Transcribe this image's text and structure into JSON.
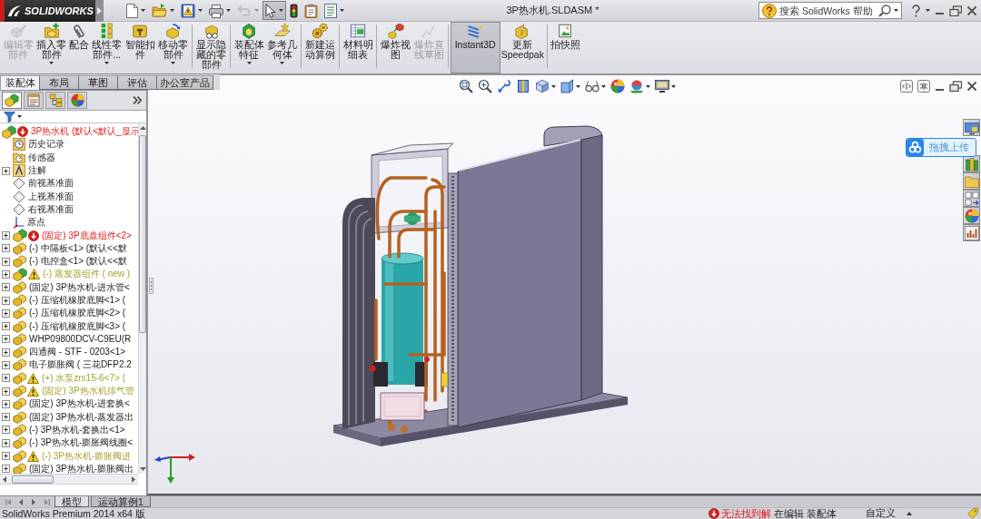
{
  "title_bar": {
    "logo": "SOLIDWORKS",
    "quick_access": [
      {
        "dropdown": true,
        "disabled": false,
        "pressed": false
      },
      {
        "dropdown": true,
        "disabled": false,
        "pressed": false
      },
      {
        "dropdown": true,
        "disabled": false,
        "pressed": false
      },
      {
        "dropdown": true,
        "disabled": false,
        "pressed": false
      },
      {
        "dropdown": true,
        "disabled": true,
        "pressed": false
      },
      {
        "dropdown": true,
        "disabled": false,
        "pressed": true
      },
      {
        "dropdown": false,
        "disabled": false,
        "pressed": false
      },
      {
        "dropdown": false,
        "disabled": false,
        "pressed": false
      },
      {
        "dropdown": true,
        "disabled": false,
        "pressed": false
      }
    ],
    "document_title": "3P热水机.SLDASM *",
    "search": {
      "placeholder": "搜索 SolidWorks 帮助"
    }
  },
  "command_manager": {
    "groups": [
      [
        {
          "label": "编辑零部件",
          "dropdown": false,
          "disabled": true,
          "pressed": false
        },
        {
          "label": "插入零部件",
          "dropdown": true,
          "disabled": false,
          "pressed": false
        },
        {
          "label": "配合",
          "dropdown": false,
          "disabled": false,
          "pressed": false
        },
        {
          "label": "线性零部件...",
          "dropdown": true,
          "disabled": false,
          "pressed": false
        },
        {
          "label": "智能扣件",
          "dropdown": false,
          "disabled": false,
          "pressed": false
        },
        {
          "label": "移动零部件",
          "dropdown": true,
          "disabled": false,
          "pressed": false
        }
      ],
      [
        {
          "label": "显示隐藏的零部件",
          "dropdown": false,
          "disabled": false,
          "pressed": false
        }
      ],
      [
        {
          "label": "装配体特征",
          "dropdown": true,
          "disabled": false,
          "pressed": false
        },
        {
          "label": "参考几何体",
          "dropdown": true,
          "disabled": false,
          "pressed": false
        }
      ],
      [
        {
          "label": "新建运动算例",
          "dropdown": false,
          "disabled": false,
          "pressed": false
        }
      ],
      [
        {
          "label": "材料明细表",
          "dropdown": false,
          "disabled": false,
          "pressed": false
        }
      ],
      [
        {
          "label": "爆炸视图",
          "dropdown": false,
          "disabled": false,
          "pressed": false
        },
        {
          "label": "爆炸直线草图",
          "dropdown": false,
          "disabled": true,
          "pressed": false
        }
      ],
      [
        {
          "label": "Instant3D",
          "dropdown": false,
          "disabled": false,
          "pressed": true
        },
        {
          "label": "更新Speedpak",
          "dropdown": false,
          "disabled": false,
          "pressed": false
        }
      ],
      [
        {
          "label": "拍快照",
          "dropdown": false,
          "disabled": false,
          "pressed": false
        }
      ]
    ]
  },
  "tabs": [
    {
      "label": "装配体",
      "selected": true
    },
    {
      "label": "布局",
      "selected": false
    },
    {
      "label": "草图",
      "selected": false
    },
    {
      "label": "评估",
      "selected": false
    },
    {
      "label": "办公室产品",
      "selected": false
    }
  ],
  "view_toolbar": [
    {
      "dropdown": false
    },
    {
      "dropdown": false
    },
    {
      "dropdown": false
    },
    {
      "dropdown": false
    },
    {
      "dropdown": true
    },
    {
      "dropdown": true
    },
    {
      "dropdown": true
    },
    {
      "dropdown": false
    },
    {
      "dropdown": true
    },
    {
      "dropdown": true
    }
  ],
  "feature_manager": {
    "panel_tabs": [
      {
        "selected": true
      },
      {
        "selected": false
      },
      {
        "selected": false
      },
      {
        "selected": false
      }
    ],
    "tree": {
      "label": "3P热水机 (默认<默认_显示",
      "kind": "assembly",
      "error": true,
      "warning": false,
      "children": [
        {
          "label": "历史记录",
          "kind": "history",
          "error": false,
          "warning": false,
          "expandable": false
        },
        {
          "label": "传感器",
          "kind": "sensors",
          "error": false,
          "warning": false,
          "expandable": false
        },
        {
          "label": "注解",
          "kind": "annotations",
          "error": false,
          "warning": false,
          "expandable": true
        },
        {
          "label": "前视基准面",
          "kind": "plane",
          "error": false,
          "warning": false,
          "expandable": false
        },
        {
          "label": "上视基准面",
          "kind": "plane",
          "error": false,
          "warning": false,
          "expandable": false
        },
        {
          "label": "右视基准面",
          "kind": "plane",
          "error": false,
          "warning": false,
          "expandable": false
        },
        {
          "label": "原点",
          "kind": "origin",
          "error": false,
          "warning": false,
          "expandable": false
        },
        {
          "label": "(固定) 3P底盘组件<2>",
          "kind": "assembly",
          "error": true,
          "warning": false,
          "expandable": true
        },
        {
          "label": "(-) 中隔板<1> (默认<<默",
          "kind": "part",
          "error": false,
          "warning": false,
          "expandable": true
        },
        {
          "label": "(-) 电控盒<1> (默认<<默",
          "kind": "part",
          "error": false,
          "warning": false,
          "expandable": true
        },
        {
          "label": "(-) 蒸发器组件 ( new )",
          "kind": "assembly",
          "error": false,
          "warning": true,
          "expandable": true
        },
        {
          "label": "(固定) 3P热水机-进水管<",
          "kind": "part",
          "error": false,
          "warning": false,
          "expandable": true
        },
        {
          "label": "(-) 压缩机橡胶底脚<1> (",
          "kind": "part",
          "error": false,
          "warning": false,
          "expandable": true
        },
        {
          "label": "(-) 压缩机橡胶底脚<2> (",
          "kind": "part",
          "error": false,
          "warning": false,
          "expandable": true
        },
        {
          "label": "(-) 压缩机橡胶底脚<3> (",
          "kind": "part",
          "error": false,
          "warning": false,
          "expandable": true
        },
        {
          "label": "WHP09800DCV-C9EU(R",
          "kind": "part",
          "error": false,
          "warning": false,
          "expandable": true
        },
        {
          "label": "四通阀 - STF - 0203<1>",
          "kind": "part",
          "error": false,
          "warning": false,
          "expandable": true
        },
        {
          "label": "电子膨胀阀 ( 三花DFP2.2",
          "kind": "part",
          "error": false,
          "warning": false,
          "expandable": true
        },
        {
          "label": "(+) 水泵zrs15-6<7> (",
          "kind": "part",
          "error": false,
          "warning": true,
          "expandable": true
        },
        {
          "label": "(固定) 3P热水机排气管",
          "kind": "part",
          "error": false,
          "warning": true,
          "expandable": true
        },
        {
          "label": "(固定) 3P热水机-进套换<",
          "kind": "part",
          "error": false,
          "warning": false,
          "expandable": true
        },
        {
          "label": "(固定) 3P热水机-蒸发器出",
          "kind": "part",
          "error": false,
          "warning": false,
          "expandable": true
        },
        {
          "label": "(-) 3P热水机-套换出<1>",
          "kind": "part",
          "error": false,
          "warning": false,
          "expandable": true
        },
        {
          "label": "(-) 3P热水机-膨胀阀线圈<",
          "kind": "part",
          "error": false,
          "warning": false,
          "expandable": true
        },
        {
          "label": "(-) 3P热水机-膨胀阀进",
          "kind": "part",
          "error": false,
          "warning": true,
          "expandable": true
        },
        {
          "label": "(固定) 3P热水机-膨胀阀出",
          "kind": "part",
          "error": false,
          "warning": false,
          "expandable": true
        }
      ]
    }
  },
  "upload_widget": {
    "label": "拖拽上传"
  },
  "bottom_tabs": [
    {
      "label": "模型",
      "selected": true
    },
    {
      "label": "运动算例1",
      "selected": false
    }
  ],
  "status_bar": {
    "product": "SolidWorks Premium 2014 x64 版",
    "rebuild": {
      "label": "无法找到解",
      "error": true
    },
    "edit_mode": "在编辑 装配体",
    "units": "自定义"
  }
}
